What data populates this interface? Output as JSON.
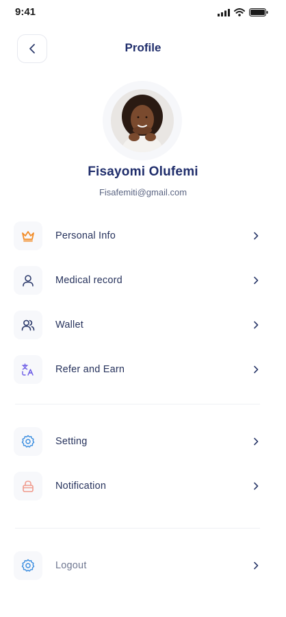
{
  "status_bar": {
    "time": "9:41"
  },
  "header": {
    "title": "Profile"
  },
  "profile": {
    "name": "Fisayomi Olufemi",
    "email": "Fisafemiti@gmail.com"
  },
  "menu": {
    "personal_info": {
      "label": "Personal Info",
      "icon": "crown-icon",
      "color": "#f28c28"
    },
    "medical_record": {
      "label": "Medical record",
      "icon": "user-icon",
      "color": "#2c3a6b"
    },
    "wallet": {
      "label": "Wallet",
      "icon": "users-icon",
      "color": "#2c3a6b"
    },
    "refer_earn": {
      "label": "Refer and Earn",
      "icon": "translate-icon",
      "color": "#6b5be6"
    },
    "setting": {
      "label": "Setting",
      "icon": "gear-icon",
      "color": "#3d8fe0"
    },
    "notification": {
      "label": "Notification",
      "icon": "lock-icon",
      "color": "#f09a8c"
    },
    "logout": {
      "label": "Logout",
      "icon": "gear-icon",
      "color": "#3d8fe0"
    }
  }
}
